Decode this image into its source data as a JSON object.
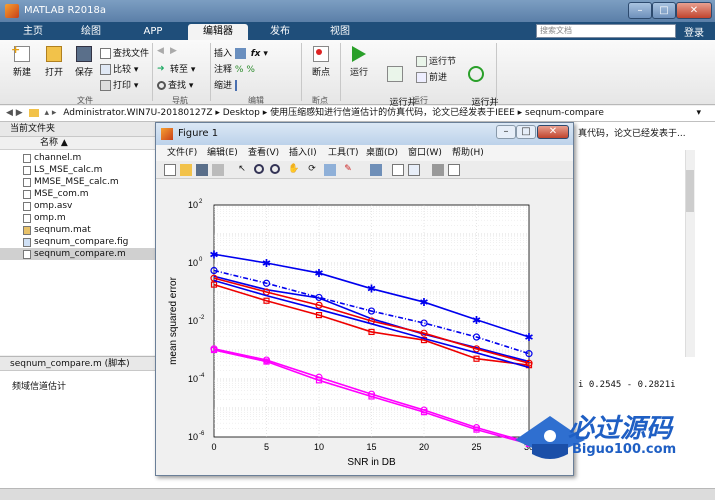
{
  "app": {
    "title": "MATLAB R2018a",
    "search_placeholder": "搜索文档",
    "login": "登录"
  },
  "tabs": [
    {
      "label": "主页",
      "active": false
    },
    {
      "label": "绘图",
      "active": false
    },
    {
      "label": "APP",
      "active": false
    },
    {
      "label": "编辑器",
      "active": true
    },
    {
      "label": "发布",
      "active": false
    },
    {
      "label": "视图",
      "active": false
    }
  ],
  "toolstrip": {
    "new": "新建",
    "open": "打开",
    "save": "保存",
    "find_files": "查找文件",
    "compare": "比较",
    "print": "打印",
    "goto": "转至",
    "find": "查找",
    "insert": "插入",
    "comment": "注释",
    "indent": "缩进",
    "breakpoints": "断点",
    "run": "运行",
    "run_advance": "运行并\n前进",
    "run_section": "运行节",
    "advance": "前进",
    "run_time": "运行并\n计时",
    "sec_file": "文件",
    "sec_nav": "导航",
    "sec_edit": "编辑",
    "sec_bp": "断点",
    "sec_run": "运行"
  },
  "address": {
    "path": "Administrator.WIN7U-20180127Z  ▸  Desktop  ▸  使用压缩感知进行信道估计的仿真代码，论文已经发表于IEEE  ▸  seqnum-compare"
  },
  "current_folder": {
    "header": "当前文件夹",
    "col_name": "名称 ▲",
    "files": [
      {
        "name": "channel.m",
        "selected": false
      },
      {
        "name": "LS_MSE_calc.m",
        "selected": false
      },
      {
        "name": "MMSE_MSE_calc.m",
        "selected": false
      },
      {
        "name": "MSE_com.m",
        "selected": false
      },
      {
        "name": "omp.asv",
        "selected": false
      },
      {
        "name": "omp.m",
        "selected": false
      },
      {
        "name": "seqnum.mat",
        "selected": false
      },
      {
        "name": "seqnum_compare.fig",
        "selected": false
      },
      {
        "name": "seqnum_compare.m",
        "selected": true
      }
    ]
  },
  "details": {
    "header": "seqnum_compare.m  (脚本)",
    "text": "频域信道估计"
  },
  "command": {
    "partial": "真代码，论文已经发表于...",
    "output": "i   0.2545 - 0.2821i"
  },
  "figure": {
    "title": "Figure 1",
    "menu": [
      "文件(F)",
      "编辑(E)",
      "查看(V)",
      "插入(I)",
      "工具(T)",
      "桌面(D)",
      "窗口(W)",
      "帮助(H)"
    ]
  },
  "watermark": {
    "text": "必过源码",
    "sub": "Biguo100.com"
  },
  "chart_data": {
    "type": "line",
    "title": "",
    "xlabel": "SNR in DB",
    "ylabel": "mean squared error",
    "xlim": [
      0,
      30
    ],
    "ylim_log10": [
      -6,
      2
    ],
    "log_y": true,
    "grid": true,
    "xticks": [
      0,
      5,
      10,
      15,
      20,
      25,
      30
    ],
    "yticks": [
      -6,
      -4,
      -2,
      0,
      2
    ],
    "x": [
      0,
      5,
      10,
      15,
      20,
      25,
      30
    ],
    "series": [
      {
        "color": "#0000ee",
        "marker": "star",
        "dash": false,
        "values": [
          2.0,
          1.0,
          0.45,
          0.13,
          0.045,
          0.011,
          0.0028
        ]
      },
      {
        "color": "#0000ee",
        "marker": "circle",
        "dash": true,
        "values": [
          0.55,
          0.2,
          0.065,
          0.022,
          0.0085,
          0.0028,
          0.00075
        ]
      },
      {
        "color": "#0000ee",
        "marker": "none",
        "dash": false,
        "values": [
          0.35,
          0.12,
          0.062,
          0.012,
          0.0035,
          0.0012,
          0.0004
        ]
      },
      {
        "color": "#ee0000",
        "marker": "circle",
        "dash": false,
        "values": [
          0.3,
          0.1,
          0.035,
          0.01,
          0.0038,
          0.0011,
          0.00035
        ]
      },
      {
        "color": "#ee0000",
        "marker": "square",
        "dash": false,
        "values": [
          0.18,
          0.05,
          0.016,
          0.0042,
          0.0022,
          0.0005,
          0.0003
        ]
      },
      {
        "color": "#0000ee",
        "marker": "none",
        "dash": false,
        "values": [
          0.25,
          0.075,
          0.025,
          0.008,
          0.0025,
          0.0008,
          0.00025
        ]
      },
      {
        "color": "#ff00ff",
        "marker": "circle",
        "dash": false,
        "values": [
          0.0011,
          0.00045,
          0.000115,
          3e-05,
          8.5e-06,
          2.1e-06,
          6.5e-07
        ]
      },
      {
        "color": "#ff00ff",
        "marker": "square",
        "dash": false,
        "values": [
          0.001,
          0.0004,
          9e-05,
          2.5e-05,
          7.2e-06,
          1.8e-06,
          5.8e-07
        ]
      }
    ]
  }
}
